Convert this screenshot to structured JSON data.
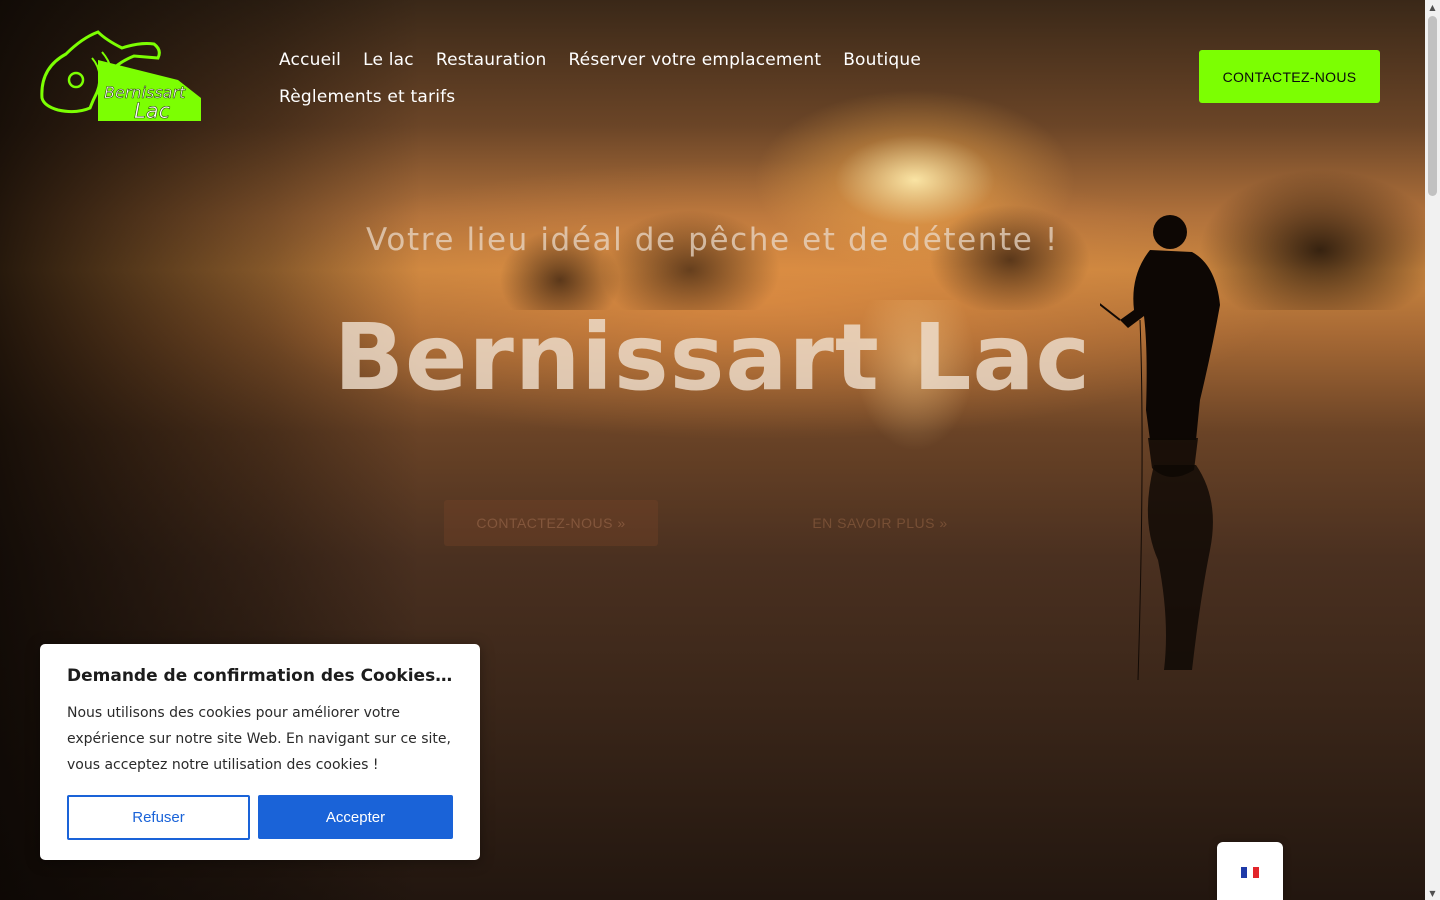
{
  "brand": {
    "logo_line1": "Bernissart",
    "logo_line2": "Lac",
    "logo_color": "#7cff02"
  },
  "nav": {
    "items": [
      "Accueil",
      "Le lac",
      "Restauration",
      "Réserver votre emplacement",
      "Boutique",
      "Règlements et tarifs"
    ]
  },
  "header": {
    "contact_label": "CONTACTEZ-NOUS",
    "contact_color": "#7cff02"
  },
  "hero": {
    "tagline": "Votre lieu idéal de pêche et de détente !",
    "title": "Bernissart Lac",
    "primary_label": "CONTACTEZ-NOUS »",
    "secondary_label": "EN SAVOIR PLUS »"
  },
  "cookie_banner": {
    "title": "Demande de confirmation des Cookies…",
    "text": "Nous utilisons des cookies pour améliorer votre expérience sur notre site Web. En navigant sur ce site, vous acceptez notre utilisation des cookies !",
    "refuse_label": "Refuser",
    "accept_label": "Accepter",
    "accent_color": "#1a63d8"
  },
  "language": {
    "flag_icon": "french-flag-icon"
  },
  "scrollbar": {
    "up_glyph": "▲",
    "down_glyph": "▼"
  }
}
